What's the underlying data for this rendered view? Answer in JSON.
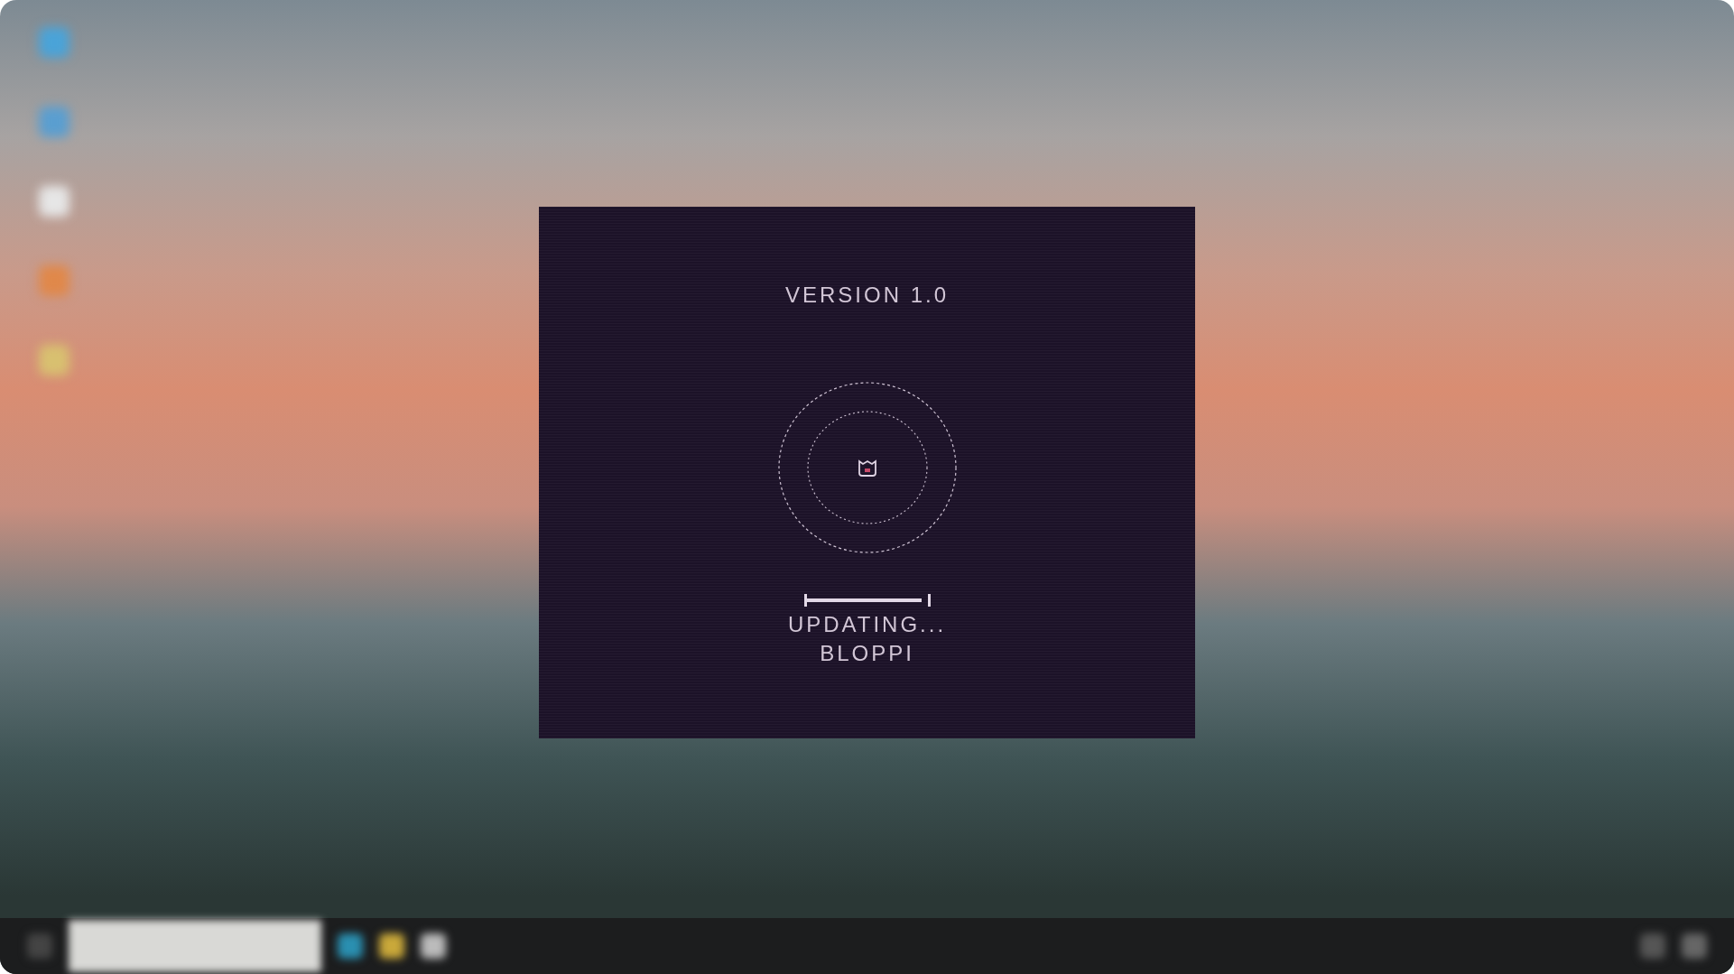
{
  "splash": {
    "version": "VERSION 1.0",
    "progress": {
      "level": 0.95
    },
    "status": "UPDATING...",
    "name": "BLOPPI"
  }
}
